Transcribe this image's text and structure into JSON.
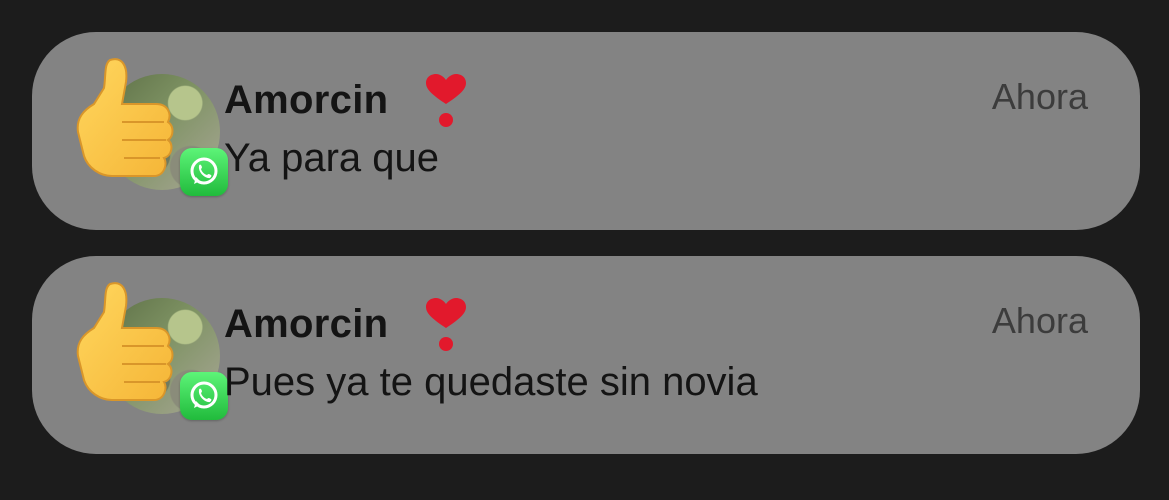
{
  "notifications": [
    {
      "sender": "Amorcin",
      "emoji": "heavy-heart-exclamation",
      "time": "Ahora",
      "message": "Ya para que",
      "app_icon": "whatsapp-icon"
    },
    {
      "sender": "Amorcin",
      "emoji": "heavy-heart-exclamation",
      "time": "Ahora",
      "message": "Pues ya te quedaste sin novia",
      "app_icon": "whatsapp-icon"
    }
  ],
  "colors": {
    "background": "#1c1c1c",
    "card": "#838383",
    "text": "#141414",
    "time_text": "#3c3c3c",
    "whatsapp_green": "#25d366",
    "heart_red": "#e2192c"
  }
}
